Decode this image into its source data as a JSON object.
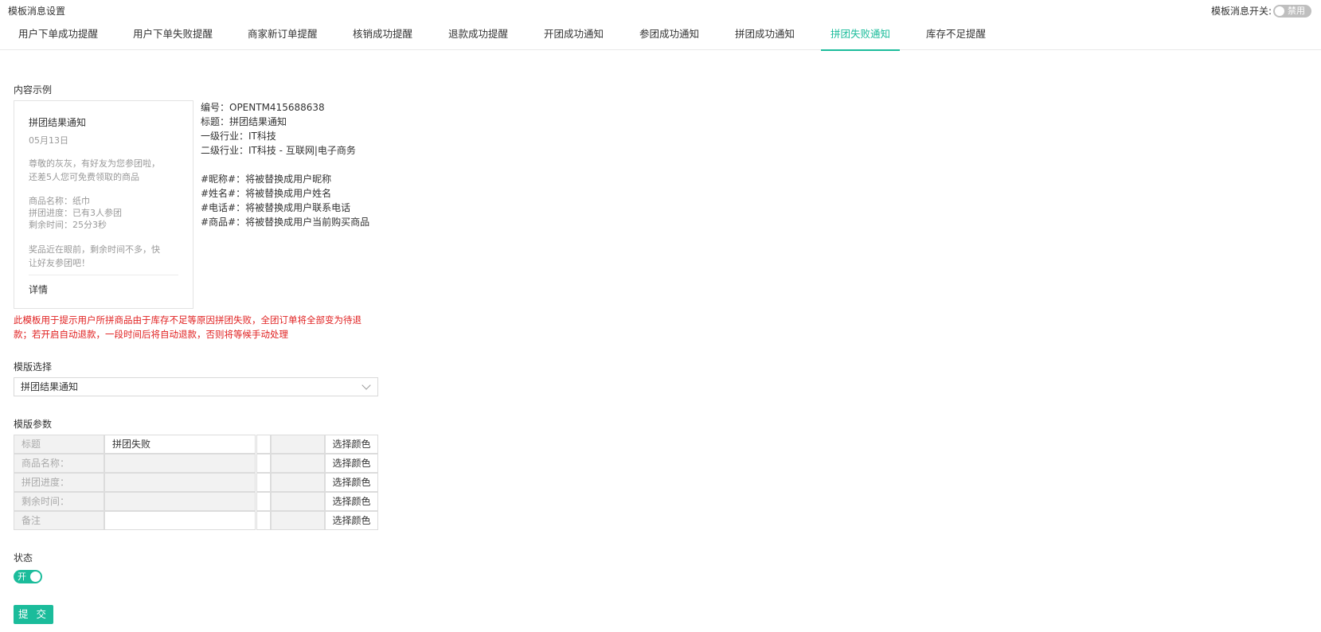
{
  "header": {
    "title": "模板消息设置",
    "switch_label": "模板消息开关:",
    "switch_state": "禁用"
  },
  "tabs": [
    {
      "label": "用户下单成功提醒"
    },
    {
      "label": "用户下单失败提醒"
    },
    {
      "label": "商家新订单提醒"
    },
    {
      "label": "核销成功提醒"
    },
    {
      "label": "退款成功提醒"
    },
    {
      "label": "开团成功通知"
    },
    {
      "label": "参团成功通知"
    },
    {
      "label": "拼团成功通知"
    },
    {
      "label": "拼团失败通知",
      "active": true
    },
    {
      "label": "库存不足提醒"
    }
  ],
  "example": {
    "label": "内容示例",
    "card": {
      "title": "拼团结果通知",
      "date": "05月13日",
      "greeting": [
        "尊敬的灰灰，有好友为您参团啦，",
        "还差5人您可免费领取的商品"
      ],
      "fields": [
        "商品名称：纸巾",
        "拼团进度：已有3人参团",
        "剩余时间：25分3秒"
      ],
      "remark": [
        "奖品近在眼前，剩余时间不多，快",
        "让好友参团吧！"
      ],
      "detail": "详情"
    },
    "info": [
      "编号：OPENTM415688638",
      "标题：拼团结果通知",
      "一级行业：IT科技",
      "二级行业：IT科技 - 互联网|电子商务",
      "",
      "#昵称#：将被替换成用户昵称",
      "#姓名#：将被替换成用户姓名",
      "#电话#：将被替换成用户联系电话",
      "#商品#：将被替换成用户当前购买商品"
    ]
  },
  "warning": [
    "此模板用于提示用户所拼商品由于库存不足等原因拼团失败，全团订单将全部变为待退",
    "款；若开启自动退款，一段时间后将自动退款，否则将等候手动处理"
  ],
  "template_select": {
    "label": "模版选择",
    "value": "拼团结果通知"
  },
  "params": {
    "label": "模版参数",
    "color_button": "选择颜色",
    "rows": [
      {
        "label": "标题",
        "value": "拼团失败"
      },
      {
        "label": "商品名称：",
        "value": ""
      },
      {
        "label": "拼团进度：",
        "value": ""
      },
      {
        "label": "剩余时间：",
        "value": ""
      },
      {
        "label": "备注",
        "value": ""
      }
    ]
  },
  "status": {
    "label": "状态",
    "toggle": "开"
  },
  "submit_label": "提 交",
  "colors": {
    "accent": "#1bbc9b",
    "warning": "#e02020",
    "toggle_off": "#bfbfbf"
  }
}
